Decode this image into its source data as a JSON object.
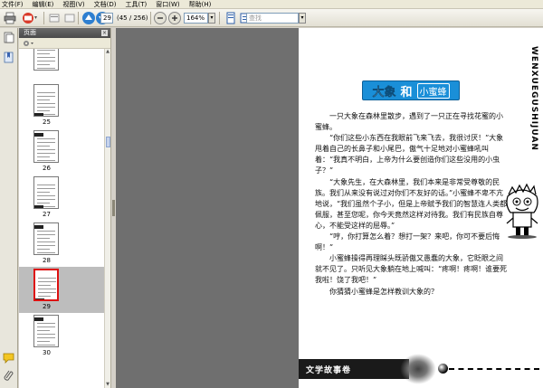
{
  "menu": [
    "文件(F)",
    "编辑(E)",
    "视图(V)",
    "文档(D)",
    "工具(T)",
    "窗口(W)",
    "帮助(H)"
  ],
  "toolbar": {
    "current_page": "29",
    "page_count": "(45 / 256)",
    "zoom": "164%",
    "find_placeholder": "查找"
  },
  "sidebar": {
    "title": "页面",
    "pages": [
      {
        "label": "",
        "selected": false
      },
      {
        "label": "25",
        "selected": false
      },
      {
        "label": "26",
        "selected": false
      },
      {
        "label": "27",
        "selected": false
      },
      {
        "label": "28",
        "selected": false
      },
      {
        "label": "29",
        "selected": true
      },
      {
        "label": "30",
        "selected": false
      }
    ]
  },
  "document": {
    "title_main": "大象",
    "title_and": "和",
    "title_sub": "小蜜蜂",
    "vertical_text": "WENXUEGUSHIJUAN",
    "paragraphs": [
      "一只大象在森林里散步，遇到了一只正在寻找花蜜的小蜜蜂。",
      "“你们这些小东西在我眼前飞来飞去，我很讨厌！”大象甩着自己的长鼻子和小尾巴，傲气十足地对小蜜蜂吼叫着：“我真不明白，上帝为什么要创造你们这些没用的小虫子？”",
      "“大象先生，在大森林里，我们本来是非常受尊敬的民族。我们从来没有说过对你们不友好的话。”小蜜蜂不卑不亢地说，“我们虽然个子小，但是上帝赋予我们的智慧连人类都佩服，甚至您呢，你今天竟然这样对待我。我们有民族自尊心，不能受这样的屈辱。”",
      "“哼，你打算怎么着？想打一架？来吧，你可不要后悔啊！”",
      "小蜜蜂操得再理睬头既骄傲又愚蠢的大象，它眨眼之间就不见了。只听见大象躺在地上喊叫：“疼啊！疼啊！谁要死我啦！饶了我吧！”",
      "你猜猜小蜜蜂是怎样教训大象的？"
    ],
    "footer_label": "文学故事卷"
  }
}
